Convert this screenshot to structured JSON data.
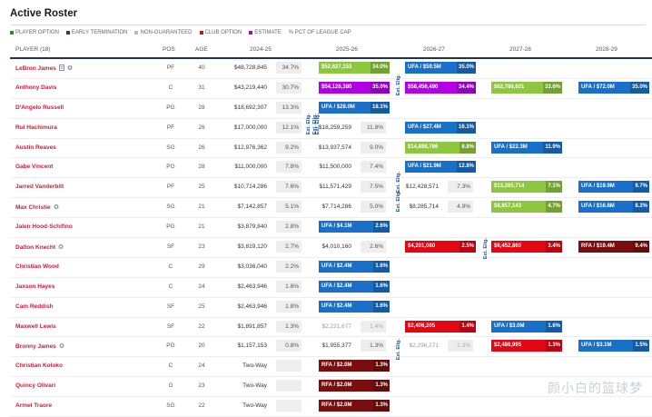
{
  "title": "Active Roster",
  "legend": [
    {
      "label": "PLAYER OPTION",
      "color": "#2e8b2e"
    },
    {
      "label": "EARLY TERMINATION",
      "color": "#1f4f1f"
    },
    {
      "label": "NON-GUARANTEED",
      "color": "#bbbbbb"
    },
    {
      "label": "CLUB OPTION",
      "color": "#d11111"
    },
    {
      "label": "ESTIMATE",
      "color": "#b100c8"
    },
    {
      "label": "% PCT OF LEAGUE CAP",
      "color": ""
    }
  ],
  "headers": {
    "player": "PLAYER (18)",
    "pos": "POS",
    "age": "AGE",
    "y1": "2024-25",
    "y2": "2025-26",
    "y3": "2026-27",
    "y4": "2027-28",
    "y5": "2028-29"
  },
  "colors": {
    "green": "#8dc63f",
    "purple": "#b100e6",
    "blue": "#1a6fc9",
    "red": "#e30613",
    "darkred": "#7a0e0e",
    "navy": "#1f2f5f"
  },
  "vertical_labels": [
    "Ext. Elig.",
    "Ext. Elig.",
    "Ext. Elig.",
    "Ext. Elig.",
    "Ext. Elig.",
    "Ext. Elig.",
    "Ext. Elig.",
    "Ext. Elig."
  ],
  "rows": [
    {
      "name": "LeBron James",
      "icons": [
        "doc-icon",
        "stack-icon"
      ],
      "pos": "PF",
      "age": "40",
      "c1": {
        "t": "$48,728,845",
        "p": "34.7%"
      },
      "c2": {
        "k": "green",
        "t": "$52,627,153",
        "p": "34.0%"
      },
      "c3": {
        "k": "blue",
        "t": "UFA / $59.5M",
        "p": "35.0%"
      }
    },
    {
      "name": "Anthony Davis",
      "icons": [],
      "pos": "C",
      "age": "31",
      "c1": {
        "t": "$43,219,440",
        "p": "30.7%"
      },
      "c2": {
        "k": "purple",
        "t": "$54,126,380",
        "p": "35.0%"
      },
      "c3": {
        "k": "purple",
        "t": "$58,456,490",
        "p": "34.4%"
      },
      "c4": {
        "k": "green",
        "t": "$62,786,601",
        "p": "33.6%"
      },
      "c5": {
        "k": "blue",
        "t": "UFA / $72.0M",
        "p": "35.0%"
      }
    },
    {
      "name": "D'Angelo Russell",
      "icons": [],
      "pos": "PG",
      "age": "28",
      "c1": {
        "t": "$18,692,307",
        "p": "13.3%"
      },
      "c2": {
        "k": "blue",
        "t": "UFA / $28.0M",
        "p": "18.1%"
      }
    },
    {
      "name": "Rui Hachimura",
      "icons": [],
      "pos": "PF",
      "age": "26",
      "c1": {
        "t": "$17,000,000",
        "p": "12.1%"
      },
      "c2": {
        "t": "$18,259,259",
        "p": "11.8%"
      },
      "c3": {
        "k": "blue",
        "t": "UFA / $27.4M",
        "p": "16.1%"
      }
    },
    {
      "name": "Austin Reaves",
      "icons": [],
      "pos": "SG",
      "age": "26",
      "c1": {
        "t": "$12,976,362",
        "p": "9.2%"
      },
      "c2": {
        "t": "$13,937,574",
        "p": "9.0%"
      },
      "c3": {
        "k": "green",
        "t": "$14,898,786",
        "p": "8.8%"
      },
      "c4": {
        "k": "blue",
        "t": "UFA / $22.3M",
        "p": "11.9%"
      }
    },
    {
      "name": "Gabe Vincent",
      "icons": [],
      "pos": "PG",
      "age": "28",
      "c1": {
        "t": "$11,000,000",
        "p": "7.8%"
      },
      "c2": {
        "t": "$11,500,000",
        "p": "7.4%"
      },
      "c3": {
        "k": "blue",
        "t": "UFA / $21.9M",
        "p": "12.8%"
      }
    },
    {
      "name": "Jarred Vanderbilt",
      "icons": [],
      "pos": "PF",
      "age": "25",
      "c1": {
        "t": "$10,714,286",
        "p": "7.6%"
      },
      "c2": {
        "t": "$11,571,429",
        "p": "7.5%"
      },
      "c3": {
        "t": "$12,428,571",
        "p": "7.3%"
      },
      "c4": {
        "k": "green",
        "t": "$13,285,714",
        "p": "7.1%"
      },
      "c5": {
        "k": "blue",
        "t": "UFA / $19.9M",
        "p": "9.7%"
      }
    },
    {
      "name": "Max Christie",
      "icons": [
        "stack-icon"
      ],
      "pos": "SG",
      "age": "21",
      "c1": {
        "t": "$7,142,857",
        "p": "5.1%"
      },
      "c2": {
        "t": "$7,714,286",
        "p": "5.0%"
      },
      "c3": {
        "t": "$8,285,714",
        "p": "4.9%"
      },
      "c4": {
        "k": "green",
        "t": "$8,857,143",
        "p": "4.7%"
      },
      "c5": {
        "k": "blue",
        "t": "UFA / $16.8M",
        "p": "8.2%"
      }
    },
    {
      "name": "Jalen Hood-Schifino",
      "icons": [],
      "pos": "PG",
      "age": "21",
      "c1": {
        "t": "$3,879,840",
        "p": "2.8%"
      },
      "c2": {
        "k": "blue",
        "t": "UFA / $4.1M",
        "p": "2.6%"
      }
    },
    {
      "name": "Dalton Knecht",
      "icons": [
        "stack-icon"
      ],
      "pos": "SF",
      "age": "23",
      "c1": {
        "t": "$3,819,120",
        "p": "2.7%"
      },
      "c2": {
        "t": "$4,010,160",
        "p": "2.6%"
      },
      "c3": {
        "k": "red",
        "t": "$4,201,080",
        "p": "2.5%"
      },
      "c4": {
        "k": "red",
        "t": "$6,452,860",
        "p": "3.4%"
      },
      "c5": {
        "k": "darkred",
        "t": "RFA / $19.4M",
        "p": "9.4%"
      }
    },
    {
      "name": "Christian Wood",
      "icons": [],
      "pos": "C",
      "age": "29",
      "c1": {
        "t": "$3,036,040",
        "p": "2.2%"
      },
      "c2": {
        "k": "blue",
        "t": "UFA / $2.4M",
        "p": "1.6%"
      }
    },
    {
      "name": "Jaxson Hayes",
      "icons": [],
      "pos": "C",
      "age": "24",
      "c1": {
        "t": "$2,463,946",
        "p": "1.8%"
      },
      "c2": {
        "k": "blue",
        "t": "UFA / $2.4M",
        "p": "1.6%"
      }
    },
    {
      "name": "Cam Reddish",
      "icons": [],
      "pos": "SF",
      "age": "25",
      "c1": {
        "t": "$2,463,946",
        "p": "1.8%"
      },
      "c2": {
        "k": "blue",
        "t": "UFA / $2.4M",
        "p": "1.6%"
      }
    },
    {
      "name": "Maxwell Lewis",
      "icons": [],
      "pos": "SF",
      "age": "22",
      "c1": {
        "t": "$1,891,857",
        "p": "1.3%"
      },
      "c2": {
        "t": "$2,221,677",
        "p": "1.4%",
        "g": true
      },
      "c3": {
        "k": "red",
        "t": "$2,406,205",
        "p": "1.4%"
      },
      "c4": {
        "k": "blue",
        "t": "UFA / $3.0M",
        "p": "1.6%"
      }
    },
    {
      "name": "Bronny James",
      "icons": [
        "stack-icon"
      ],
      "pos": "PG",
      "age": "20",
      "c1": {
        "t": "$1,157,153",
        "p": "0.8%"
      },
      "c2": {
        "t": "$1,955,377",
        "p": "1.3%"
      },
      "c3": {
        "t": "$2,296,271",
        "p": "1.3%",
        "g": true
      },
      "c4": {
        "k": "red",
        "t": "$2,486,995",
        "p": "1.3%"
      },
      "c5": {
        "k": "blue",
        "t": "UFA / $3.1M",
        "p": "1.5%"
      }
    },
    {
      "name": "Christian Koloko",
      "icons": [],
      "pos": "C",
      "age": "24",
      "c1": {
        "t": "Two-Way",
        "p": ""
      },
      "c2": {
        "k": "darkred",
        "t": "RFA / $2.0M",
        "p": "1.3%"
      }
    },
    {
      "name": "Quincy Olivari",
      "icons": [],
      "pos": "G",
      "age": "23",
      "c1": {
        "t": "Two-Way",
        "p": ""
      },
      "c2": {
        "k": "darkred",
        "t": "RFA / $2.0M",
        "p": "1.3%"
      }
    },
    {
      "name": "Armel Traore",
      "icons": [],
      "pos": "SG",
      "age": "22",
      "c1": {
        "t": "Two-Way",
        "p": ""
      },
      "c2": {
        "k": "darkred",
        "t": "RFA / $2.0M",
        "p": "1.3%"
      }
    }
  ],
  "watermark": "颜小白的篮球梦"
}
